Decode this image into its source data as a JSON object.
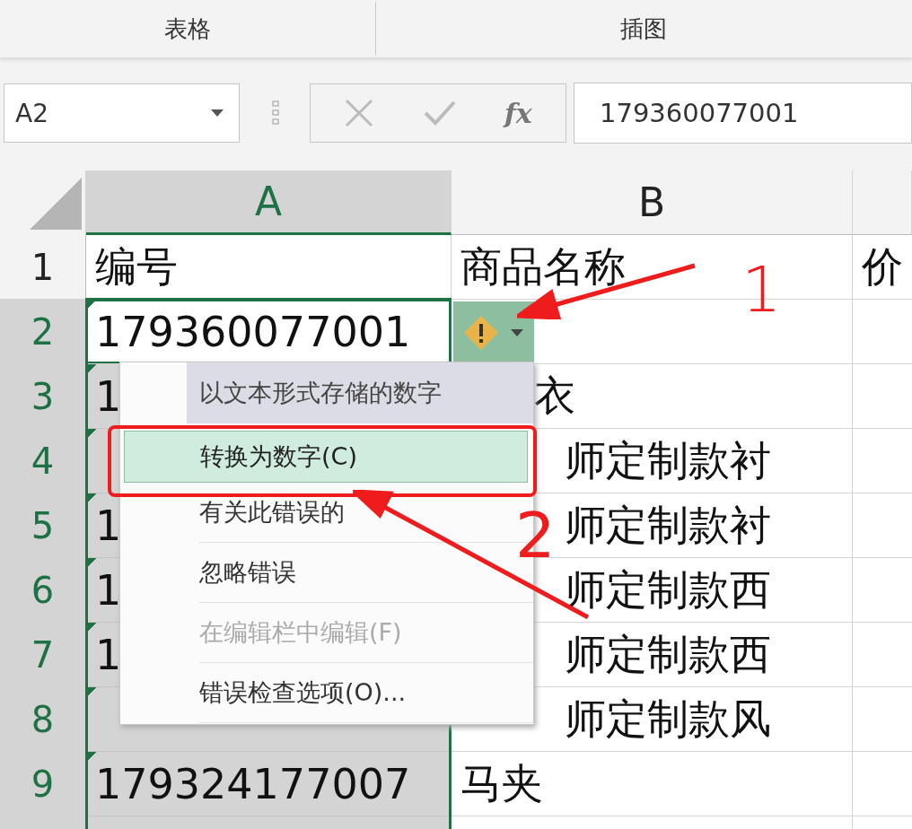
{
  "ribbon_groups": [
    {
      "label": "表格"
    },
    {
      "label": "插图"
    }
  ],
  "formula_bar": {
    "name_box": "A2",
    "fx": "fx",
    "value": "179360077001"
  },
  "columns": [
    {
      "label": "A",
      "selected": true
    },
    {
      "label": "B",
      "selected": false
    }
  ],
  "rows": [
    {
      "number": "1",
      "selected": false,
      "active": false,
      "a_text": "编号",
      "a_error": false,
      "b_text": "商品名称",
      "c_text": "价"
    },
    {
      "number": "2",
      "selected": true,
      "active": true,
      "a_text": "179360077001",
      "a_error": true
    },
    {
      "number": "3",
      "selected": true,
      "active": false,
      "a_text": "1",
      "a_error": true,
      "b_text": "衣"
    },
    {
      "number": "4",
      "selected": true,
      "active": false,
      "a_error": true,
      "b_text": "师定制款衬"
    },
    {
      "number": "5",
      "selected": true,
      "active": false,
      "a_text": "1",
      "a_error": true,
      "b_text": "师定制款衬"
    },
    {
      "number": "6",
      "selected": true,
      "active": false,
      "a_text": "1",
      "a_error": true,
      "b_text": "师定制款西"
    },
    {
      "number": "7",
      "selected": true,
      "active": false,
      "a_text": "1",
      "a_error": true,
      "b_text": "师定制款西"
    },
    {
      "number": "8",
      "selected": true,
      "active": false,
      "a_error": true,
      "b_text": "师定制款风"
    },
    {
      "number": "9",
      "selected": true,
      "active": false,
      "a_text": "179324177007",
      "a_error": true,
      "b_text": "马夹"
    }
  ],
  "error_menu": {
    "items": [
      {
        "kind": "header",
        "label": "以文本形式存储的数字"
      },
      {
        "kind": "item",
        "label": "转换为数字(C)",
        "selected": true,
        "disabled": false
      },
      {
        "kind": "item",
        "label": "有关此错误的",
        "selected": false,
        "disabled": false
      },
      {
        "kind": "item",
        "label": "忽略错误",
        "selected": false,
        "disabled": false
      },
      {
        "kind": "item",
        "label": "在编辑栏中编辑(F)",
        "selected": false,
        "disabled": true
      },
      {
        "kind": "item",
        "label": "错误检查选项(O)...",
        "selected": false,
        "disabled": false
      }
    ]
  },
  "callouts": [
    {
      "label": "1"
    },
    {
      "label": "2"
    }
  ]
}
